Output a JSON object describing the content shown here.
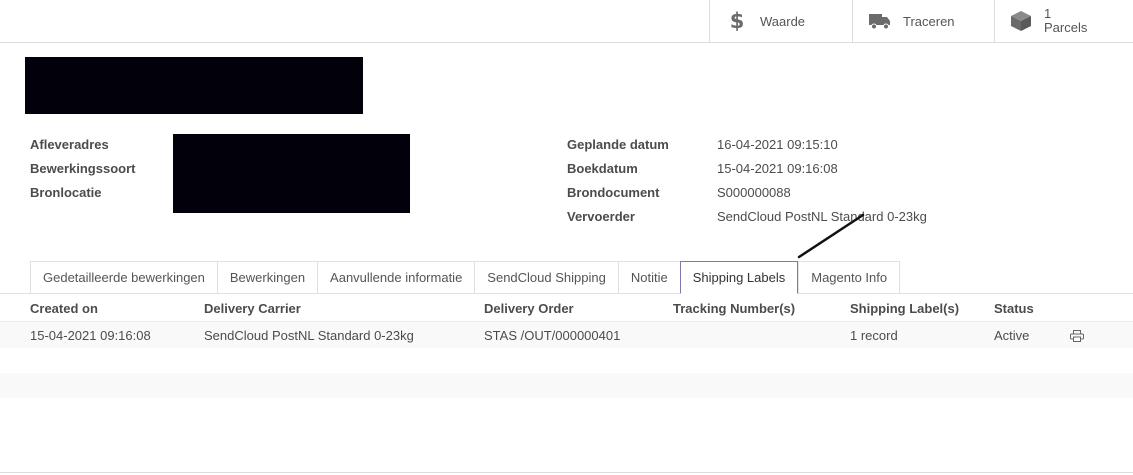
{
  "smart_buttons": {
    "waarde": "Waarde",
    "traceren": "Traceren",
    "parcels_count": "1",
    "parcels_label": "Parcels"
  },
  "fields_left": {
    "afleveradres": "Afleveradres",
    "bewerkingssoort": "Bewerkingssoort",
    "bronlocatie": "Bronlocatie"
  },
  "fields_right": [
    {
      "label": "Geplande datum",
      "value": "16-04-2021 09:15:10"
    },
    {
      "label": "Boekdatum",
      "value": "15-04-2021 09:16:08"
    },
    {
      "label": "Brondocument",
      "value": "S000000088"
    },
    {
      "label": "Vervoerder",
      "value": "SendCloud PostNL Standard 0-23kg"
    }
  ],
  "tabs": [
    "Gedetailleerde bewerkingen",
    "Bewerkingen",
    "Aanvullende informatie",
    "SendCloud Shipping",
    "Notitie",
    "Shipping Labels",
    "Magento Info"
  ],
  "active_tab": "Shipping Labels",
  "table": {
    "headers": [
      "Created on",
      "Delivery Carrier",
      "Delivery Order",
      "Tracking Number(s)",
      "Shipping Label(s)",
      "Status"
    ],
    "rows": [
      {
        "created_on": "15-04-2021 09:16:08",
        "carrier": "SendCloud PostNL Standard 0-23kg",
        "order": "STAS /OUT/000000401",
        "tracking": "",
        "labels": "1 record",
        "status": "Active"
      }
    ]
  },
  "colors": {
    "active_tab_border": "#7c7bad",
    "redaction": "#02010b"
  }
}
